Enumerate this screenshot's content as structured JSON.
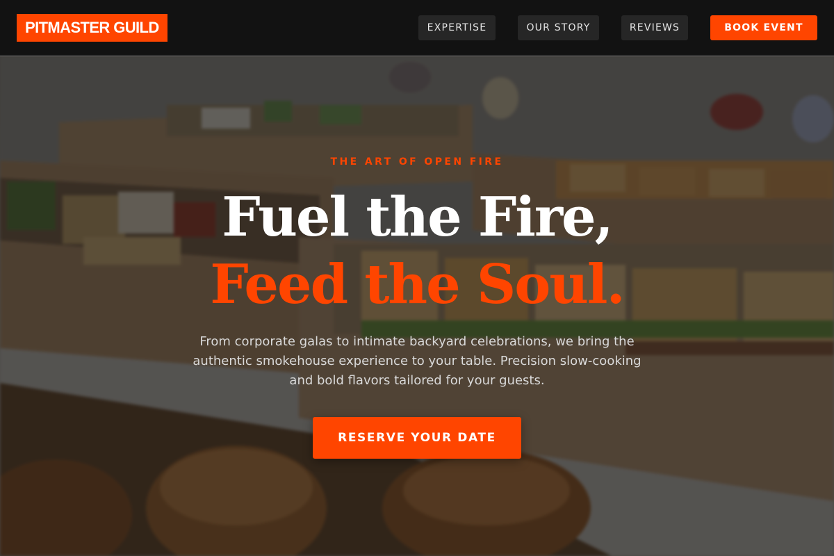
{
  "brand": {
    "logo_text": "PITMASTER GUILD",
    "accent_color": "#ff4500"
  },
  "nav": {
    "items": [
      {
        "label": "EXPERTISE"
      },
      {
        "label": "OUR STORY"
      },
      {
        "label": "REVIEWS"
      }
    ],
    "cta_label": "BOOK EVENT"
  },
  "hero": {
    "eyebrow": "THE ART OF OPEN FIRE",
    "headline_line1": "Fuel the Fire,",
    "headline_line2": "Feed the Soul.",
    "subtext": "From corporate galas to intimate backyard celebrations, we bring the authentic smokehouse experience to your table. Precision slow-cooking and bold flavors tailored for your guests.",
    "cta_label": "RESERVE YOUR DATE",
    "background_image": "catering-boxes-photo"
  }
}
